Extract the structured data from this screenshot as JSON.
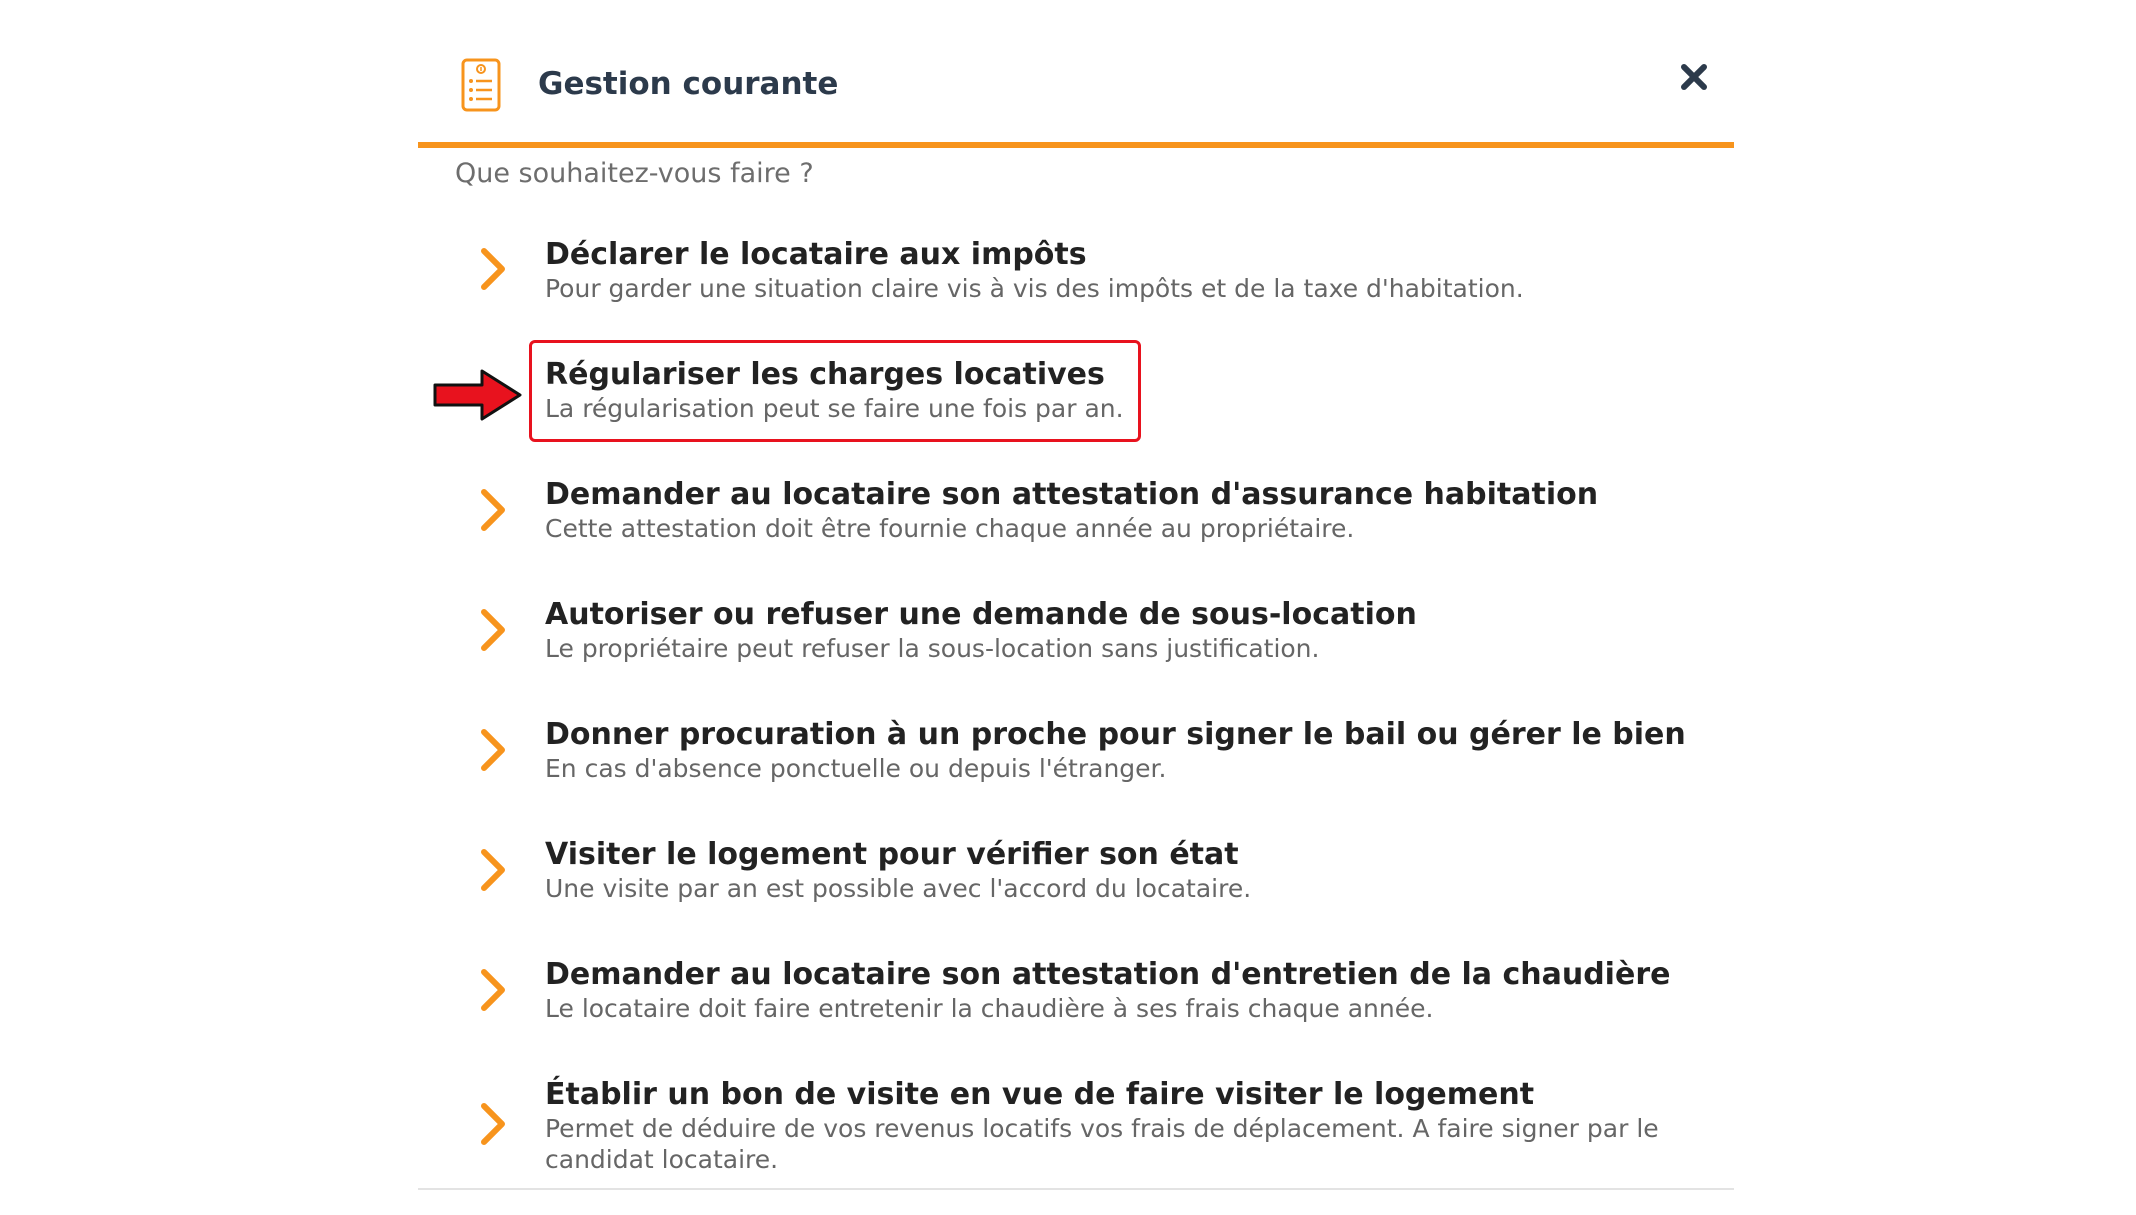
{
  "header": {
    "title": "Gestion courante",
    "icon": "checklist-document-icon",
    "close_icon": "close-icon"
  },
  "prompt": "Que souhaitez-vous faire ?",
  "colors": {
    "accent": "#f7941d",
    "title_text": "#2c3a4b",
    "highlight_border": "#e8121e",
    "pointer_arrow": "#e8121e"
  },
  "items": [
    {
      "title": "Déclarer le locataire aux impôts",
      "description": "Pour garder une situation claire vis à vis des impôts et de la taxe d'habitation.",
      "icon": "chevron-right-icon"
    },
    {
      "title": "Régulariser les charges locatives",
      "description": "La régularisation peut se faire une fois par an.",
      "icon": "chevron-right-icon",
      "highlighted": true
    },
    {
      "title": "Demander au locataire son attestation d'assurance habitation",
      "description": "Cette attestation doit être fournie chaque année au propriétaire.",
      "icon": "chevron-right-icon"
    },
    {
      "title": "Autoriser ou refuser une demande de sous-location",
      "description": "Le propriétaire peut refuser la sous-location sans justification.",
      "icon": "chevron-right-icon"
    },
    {
      "title": "Donner procuration à un proche pour signer le bail ou gérer le bien",
      "description": "En cas d'absence ponctuelle ou depuis l'étranger.",
      "icon": "chevron-right-icon"
    },
    {
      "title": "Visiter le logement pour vérifier son état",
      "description": "Une visite par an est possible avec l'accord du locataire.",
      "icon": "chevron-right-icon"
    },
    {
      "title": "Demander au locataire son attestation d'entretien de la chaudière",
      "description": "Le locataire doit faire entretenir la chaudière à ses frais chaque année.",
      "icon": "chevron-right-icon"
    },
    {
      "title": "Établir un bon de visite en vue de faire visiter le logement",
      "description": "Permet de déduire de vos revenus locatifs vos frais de déplacement. A faire signer par le candidat locataire.",
      "icon": "chevron-right-icon"
    }
  ]
}
